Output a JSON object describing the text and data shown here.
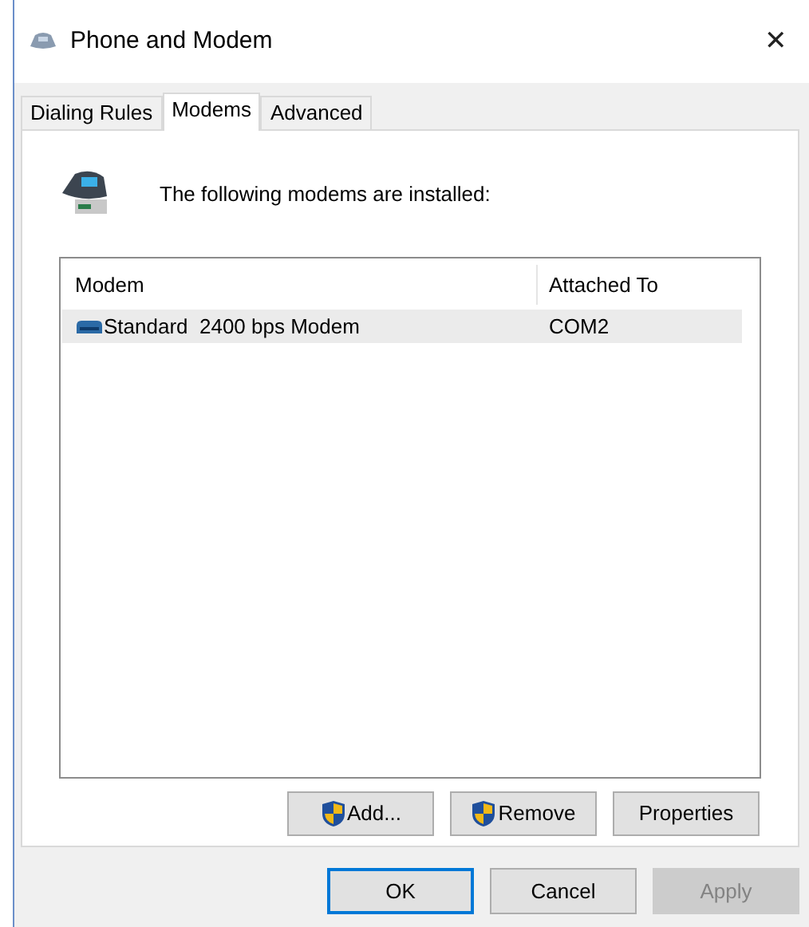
{
  "window": {
    "title": "Phone and Modem",
    "close": "✕"
  },
  "tabs": [
    {
      "label": "Dialing Rules",
      "selected": false
    },
    {
      "label": "Modems",
      "selected": true
    },
    {
      "label": "Advanced",
      "selected": false
    }
  ],
  "intro": "The following modems are installed:",
  "table": {
    "columns": [
      "Modem",
      "Attached To"
    ],
    "rows": [
      {
        "cells": [
          "Standard  2400 bps Modem",
          "COM2"
        ],
        "selected": true
      }
    ]
  },
  "list_buttons": [
    {
      "label": "Add...",
      "shield": true,
      "disabled": false
    },
    {
      "label": "Remove",
      "shield": true,
      "disabled": false
    },
    {
      "label": "Properties",
      "shield": false,
      "disabled": false
    }
  ],
  "dialog_buttons": [
    {
      "label": "OK",
      "default": true,
      "disabled": false
    },
    {
      "label": "Cancel",
      "default": false,
      "disabled": false
    },
    {
      "label": "Apply",
      "default": false,
      "disabled": true
    }
  ]
}
